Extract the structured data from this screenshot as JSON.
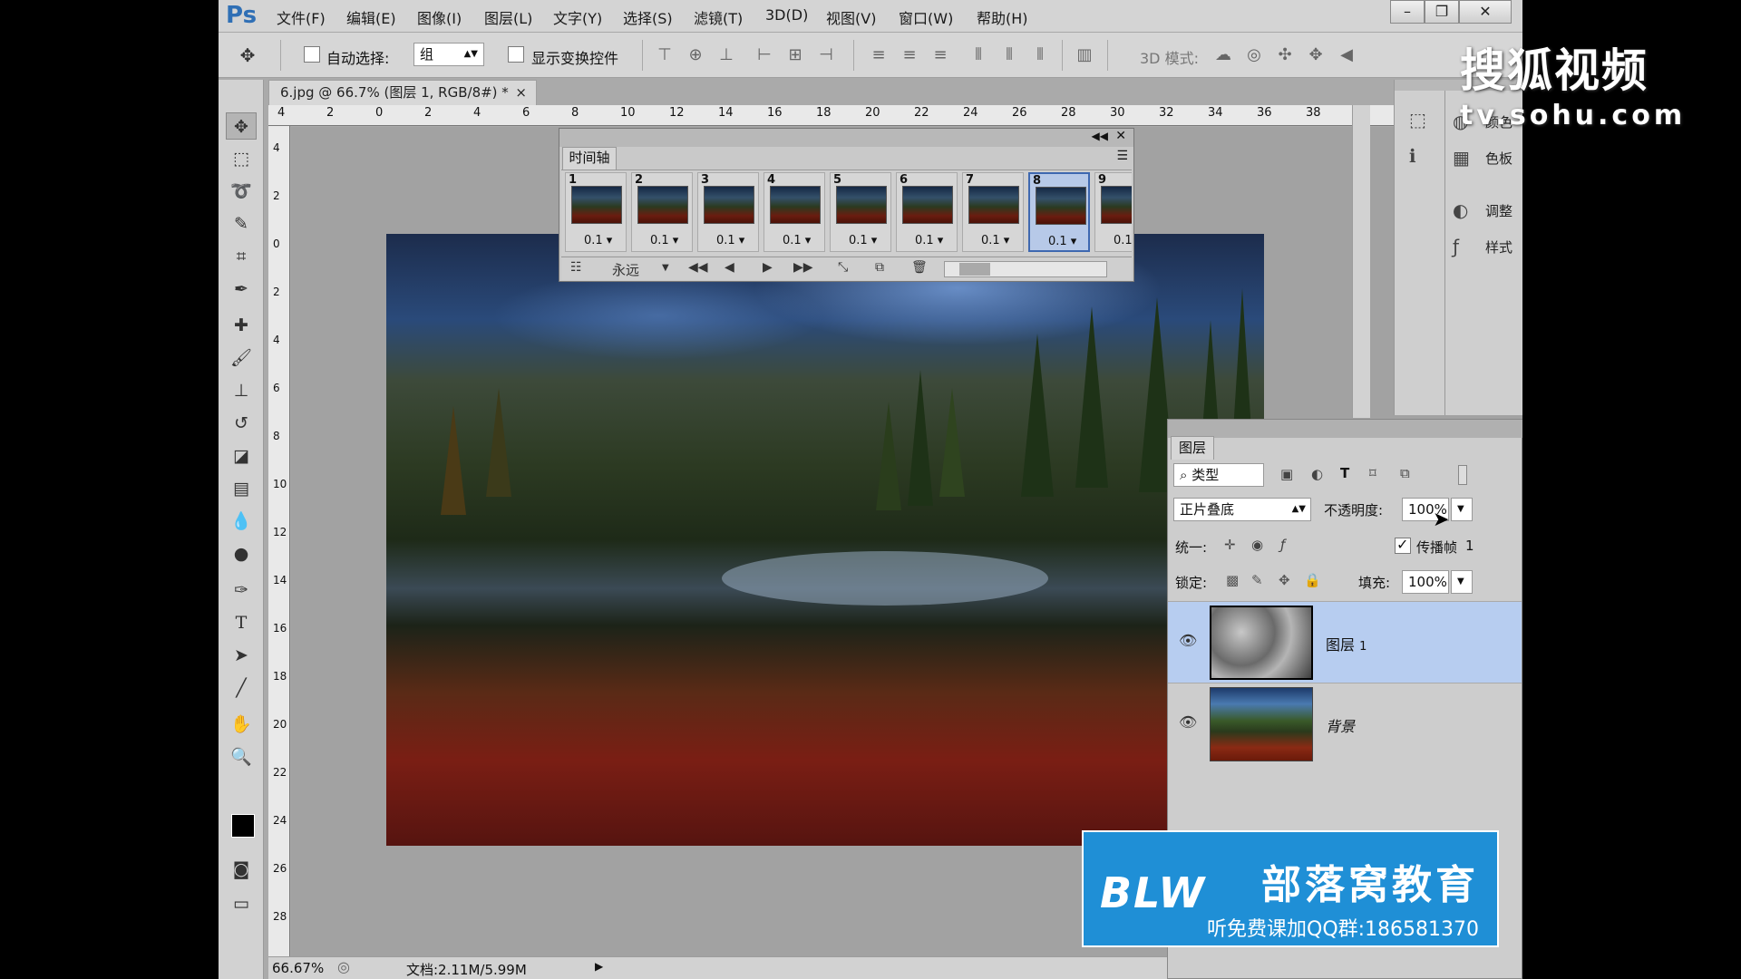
{
  "app": {
    "logo": "Ps"
  },
  "menu": [
    "文件(F)",
    "编辑(E)",
    "图像(I)",
    "图层(L)",
    "文字(Y)",
    "选择(S)",
    "滤镜(T)",
    "3D(D)",
    "视图(V)",
    "窗口(W)",
    "帮助(H)"
  ],
  "window_controls": {
    "minimize": "–",
    "restore": "❐",
    "close": "✕"
  },
  "options": {
    "auto_select_label": "自动选择:",
    "auto_select_value": "组",
    "show_transform_label": "显示变换控件",
    "mode_3d_label": "3D 模式:"
  },
  "document": {
    "tab_title": "6.jpg @ 66.7% (图层 1, RGB/8#) *",
    "tab_close": "×",
    "hruler": [
      "4",
      "2",
      "0",
      "2",
      "4",
      "6",
      "8",
      "10",
      "12",
      "14",
      "16",
      "18",
      "20",
      "22",
      "24",
      "26",
      "28",
      "30",
      "32",
      "34",
      "36",
      "38"
    ],
    "vruler": [
      "4",
      "2",
      "0",
      "2",
      "4",
      "6",
      "8",
      "10",
      "12",
      "14",
      "16",
      "18",
      "20",
      "22",
      "24",
      "26",
      "28"
    ],
    "zoom": "66.67%",
    "doc_info": "文档:2.11M/5.99M"
  },
  "timeline": {
    "tab": "时间轴",
    "frames": [
      {
        "num": "1",
        "delay": "0.1"
      },
      {
        "num": "2",
        "delay": "0.1"
      },
      {
        "num": "3",
        "delay": "0.1"
      },
      {
        "num": "4",
        "delay": "0.1"
      },
      {
        "num": "5",
        "delay": "0.1"
      },
      {
        "num": "6",
        "delay": "0.1"
      },
      {
        "num": "7",
        "delay": "0.1"
      },
      {
        "num": "8",
        "delay": "0.1"
      },
      {
        "num": "9",
        "delay": "0.1"
      }
    ],
    "selected_frame": "8",
    "loop": "永远"
  },
  "dock": {
    "color": "颜色",
    "swatches": "色板",
    "adjustments": "调整",
    "styles": "样式"
  },
  "layers": {
    "tab": "图层",
    "filter_kind": "类型",
    "blend_mode": "正片叠底",
    "opacity_label": "不透明度:",
    "opacity": "100%",
    "unify_label": "统一:",
    "propagate_label": "传播帧",
    "propagate_value": "1",
    "lock_label": "锁定:",
    "fill_label": "填充:",
    "fill": "100%",
    "items": [
      {
        "name": "图层",
        "suffix": "1",
        "selected": true
      },
      {
        "name": "背景",
        "suffix": "",
        "selected": false
      }
    ]
  },
  "overlay": {
    "watermark": "搜狐视频",
    "watermark_url": "tv.sohu.com",
    "banner_logo": "BLW",
    "banner_title": "部落窝教育",
    "banner_sub": "听免费课加QQ群:186581370"
  },
  "colors": {
    "accent": "#2f6fb5",
    "selection": "#b7cdf0",
    "banner": "#1f8fd6"
  }
}
